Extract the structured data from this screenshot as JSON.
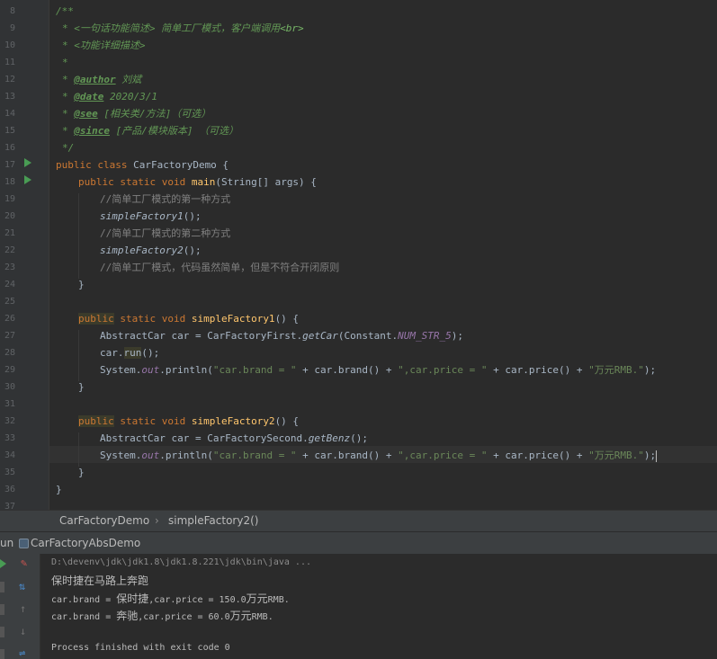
{
  "editor": {
    "line_numbers": [
      "8",
      "9",
      "10",
      "11",
      "12",
      "13",
      "14",
      "15",
      "16",
      "17",
      "18",
      "19",
      "20",
      "21",
      "22",
      "23",
      "24",
      "25",
      "26",
      "27",
      "28",
      "29",
      "30",
      "31",
      "32",
      "33",
      "34",
      "35",
      "36",
      "37"
    ],
    "lines": {
      "l8": "/**",
      "l9_star": "* ",
      "l9_text": "<一句话功能简述> 简单工厂模式，客户端调用",
      "l9_tag": "<br>",
      "l10_text": "* <功能详细描述>",
      "l11_text": "*",
      "l12_star": "* ",
      "l12_tag": "@author",
      "l12_val": " 刘斌",
      "l13_star": "* ",
      "l13_tag": "@date",
      "l13_val": " 2020/3/1",
      "l14_star": "* ",
      "l14_tag": "@see",
      "l14_val": " [相关类/方法]（可选）",
      "l15_star": "* ",
      "l15_tag": "@since",
      "l15_val": " [产品/模块版本] （可选）",
      "l16_text": "*/",
      "l17_kw": "public class ",
      "l17_rest": "CarFactoryDemo {",
      "l18_kw": "public static void ",
      "l18_fn": "main",
      "l18_rest": "(String[] args) {",
      "l19_cmt": "//简单工厂模式的第一种方式",
      "l20_call": "simpleFactory1",
      "l20_rest": "();",
      "l21_cmt": "//简单工厂模式的第二种方式",
      "l22_call": "simpleFactory2",
      "l22_rest": "();",
      "l23_cmt": "//简单工厂模式，代码虽然简单，但是不符合开闭原则",
      "l24_text": "}",
      "l26_kw1": "public",
      "l26_kw2": " static void ",
      "l26_fn": "simpleFactory1",
      "l26_rest": "() {",
      "l27_a": "AbstractCar car = CarFactoryFirst.",
      "l27_call": "getCar",
      "l27_b": "(Constant.",
      "l27_const": "NUM_STR_5",
      "l27_c": ");",
      "l28_a": "car.",
      "l28_run": "run",
      "l28_b": "();",
      "l29_a": "System.",
      "l29_out": "out",
      "l29_b": ".println(",
      "l29_s1": "\"car.brand = \"",
      "l29_c": " + car.brand() + ",
      "l29_s2": "\",car.price = \"",
      "l29_d": " + car.price() + ",
      "l29_s3": "\"万元RMB.\"",
      "l29_e": ");",
      "l30_text": "}",
      "l32_kw1": "public",
      "l32_kw2": " static void ",
      "l32_fn": "simpleFactory2",
      "l32_rest": "() {",
      "l33_a": "AbstractCar car = CarFactorySecond.",
      "l33_call": "getBenz",
      "l33_b": "();",
      "l34_a": "System.",
      "l34_out": "out",
      "l34_b": ".println(",
      "l34_s1": "\"car.brand = \"",
      "l34_c": " + car.brand() + ",
      "l34_s2": "\",car.price = \"",
      "l34_d": " + car.price() + ",
      "l34_s3": "\"万元RMB.\"",
      "l34_e": ");",
      "l35_text": "}",
      "l36_text": "}"
    }
  },
  "breadcrumb": {
    "class_name": "CarFactoryDemo",
    "separator": "›",
    "method_name": "simpleFactory2()"
  },
  "run_panel": {
    "label": "un",
    "config_name": "CarFactoryAbsDemo"
  },
  "console": {
    "command": "D:\\devenv\\jdk\\jdk1.8\\jdk1.8.221\\jdk\\bin\\java ...",
    "out1": "保时捷在马路上奔跑",
    "out2_a": "car.brand = ",
    "out2_b": "保时捷",
    "out2_c": ",car.price = 150.0",
    "out2_d": "万元",
    "out2_e": "RMB.",
    "out3_a": "car.brand = ",
    "out3_b": "奔驰",
    "out3_c": ",car.price = 60.0",
    "out3_d": "万元",
    "out3_e": "RMB.",
    "exit": "Process finished with exit code 0"
  },
  "colors": {
    "background": "#2b2b2b",
    "keyword": "#cc7832",
    "method": "#ffc66d",
    "string": "#6a8759",
    "doc": "#629755",
    "comment": "#808080",
    "field": "#9876aa",
    "run_green": "#499c54"
  }
}
